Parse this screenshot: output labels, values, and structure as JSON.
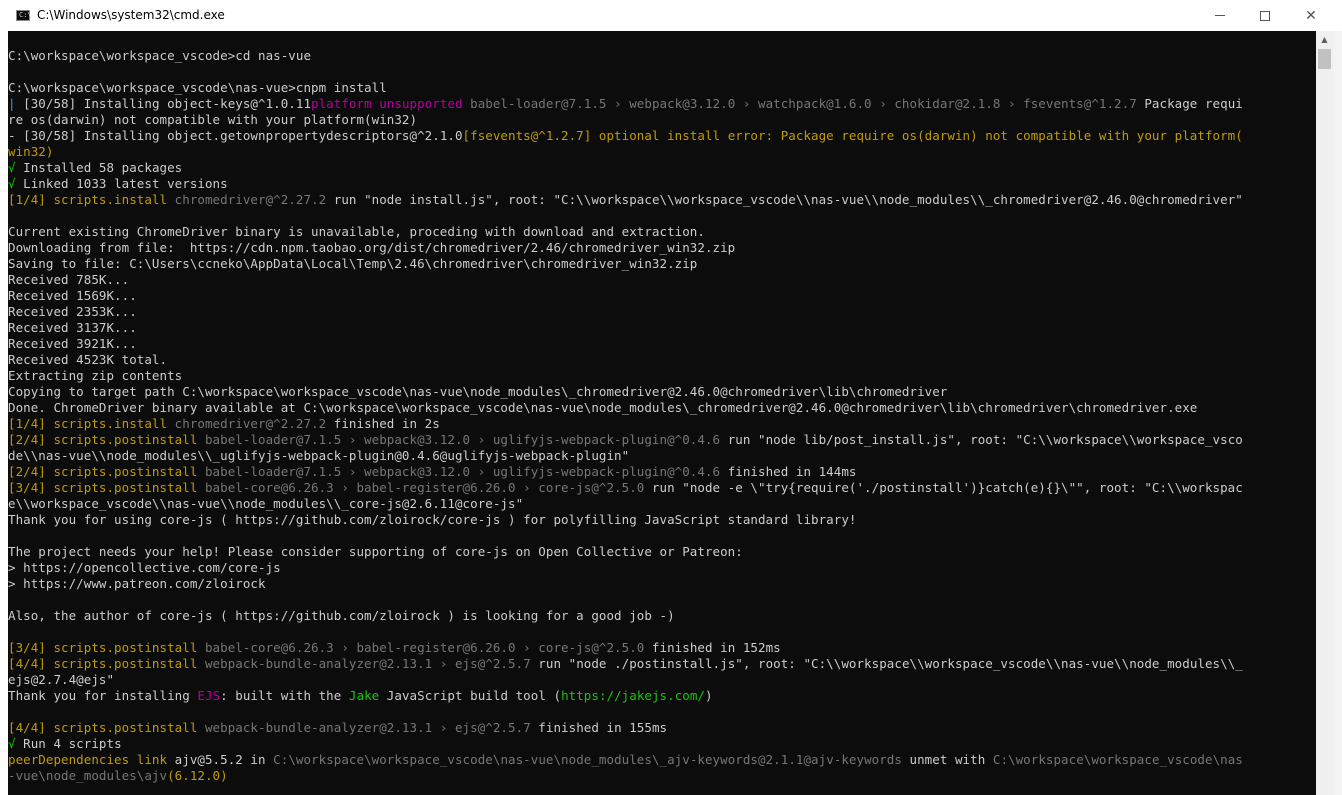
{
  "window": {
    "title": "C:\\Windows\\system32\\cmd.exe",
    "icon": "cmd-icon",
    "icon_text": "C:\\",
    "minimize_icon": "minimize-icon",
    "maximize_icon": "maximize-icon",
    "close_icon": "close-icon"
  },
  "colors": {
    "console_bg": "#0c0c0c",
    "default_text": "#cccccc",
    "blue": "#3a96dd",
    "green": "#16c60c",
    "yellow": "#c19c00",
    "gray": "#767676",
    "magenta": "#b4009e"
  },
  "console": {
    "lines": [
      [
        {
          "t": "C:\\workspace\\workspace_vscode>cd nas-vue",
          "c": "white"
        }
      ],
      [
        {
          "t": "",
          "c": "white"
        }
      ],
      [
        {
          "t": "C:\\workspace\\workspace_vscode\\nas-vue>cnpm install",
          "c": "white"
        }
      ],
      [
        {
          "t": "| ",
          "c": "blue"
        },
        {
          "t": "[30/58] Installing object-keys@^1.0.11",
          "c": "white"
        },
        {
          "t": "platform unsupported ",
          "c": "magenta"
        },
        {
          "t": "babel-loader@7.1.5 › webpack@3.12.0 › watchpack@1.6.0 › chokidar@2.1.8 › fsevents@^1.2.7",
          "c": "gray"
        },
        {
          "t": " Package requi",
          "c": "white"
        }
      ],
      [
        {
          "t": "re os(darwin) not compatible with your platform(win32)",
          "c": "white"
        }
      ],
      [
        {
          "t": "- ",
          "c": "white"
        },
        {
          "t": "[30/58] Installing object.getownpropertydescriptors@^2.1.0",
          "c": "white"
        },
        {
          "t": "[fsevents@^1.2.7] optional install error: Package require os(darwin) not compatible with your platform(",
          "c": "yellow"
        }
      ],
      [
        {
          "t": "win32)",
          "c": "yellow"
        }
      ],
      [
        {
          "t": "√ ",
          "c": "green"
        },
        {
          "t": "Installed 58 packages",
          "c": "white"
        }
      ],
      [
        {
          "t": "√ ",
          "c": "green"
        },
        {
          "t": "Linked 1033 latest versions",
          "c": "white"
        }
      ],
      [
        {
          "t": "[1/4] scripts.install ",
          "c": "yellow"
        },
        {
          "t": "chromedriver@^2.27.2",
          "c": "gray"
        },
        {
          "t": " run \"node install.js\", root: \"C:\\\\workspace\\\\workspace_vscode\\\\nas-vue\\\\node_modules\\\\_chromedriver@2.46.0@chromedriver\"",
          "c": "white"
        }
      ],
      [
        {
          "t": "",
          "c": "white"
        }
      ],
      [
        {
          "t": "Current existing ChromeDriver binary is unavailable, proceding with download and extraction.",
          "c": "white"
        }
      ],
      [
        {
          "t": "Downloading from file:  https://cdn.npm.taobao.org/dist/chromedriver/2.46/chromedriver_win32.zip",
          "c": "white"
        }
      ],
      [
        {
          "t": "Saving to file: C:\\Users\\ccneko\\AppData\\Local\\Temp\\2.46\\chromedriver\\chromedriver_win32.zip",
          "c": "white"
        }
      ],
      [
        {
          "t": "Received 785K...",
          "c": "white"
        }
      ],
      [
        {
          "t": "Received 1569K...",
          "c": "white"
        }
      ],
      [
        {
          "t": "Received 2353K...",
          "c": "white"
        }
      ],
      [
        {
          "t": "Received 3137K...",
          "c": "white"
        }
      ],
      [
        {
          "t": "Received 3921K...",
          "c": "white"
        }
      ],
      [
        {
          "t": "Received 4523K total.",
          "c": "white"
        }
      ],
      [
        {
          "t": "Extracting zip contents",
          "c": "white"
        }
      ],
      [
        {
          "t": "Copying to target path C:\\workspace\\workspace_vscode\\nas-vue\\node_modules\\_chromedriver@2.46.0@chromedriver\\lib\\chromedriver",
          "c": "white"
        }
      ],
      [
        {
          "t": "Done. ChromeDriver binary available at C:\\workspace\\workspace_vscode\\nas-vue\\node_modules\\_chromedriver@2.46.0@chromedriver\\lib\\chromedriver\\chromedriver.exe",
          "c": "white"
        }
      ],
      [
        {
          "t": "[1/4] scripts.install ",
          "c": "yellow"
        },
        {
          "t": "chromedriver@^2.27.2",
          "c": "gray"
        },
        {
          "t": " finished in 2s",
          "c": "white"
        }
      ],
      [
        {
          "t": "[2/4] scripts.postinstall ",
          "c": "yellow"
        },
        {
          "t": "babel-loader@7.1.5 › webpack@3.12.0 › uglifyjs-webpack-plugin@^0.4.6",
          "c": "gray"
        },
        {
          "t": " run \"node lib/post_install.js\", root: \"C:\\\\workspace\\\\workspace_vsco",
          "c": "white"
        }
      ],
      [
        {
          "t": "de\\\\nas-vue\\\\node_modules\\\\_uglifyjs-webpack-plugin@0.4.6@uglifyjs-webpack-plugin\"",
          "c": "white"
        }
      ],
      [
        {
          "t": "[2/4] scripts.postinstall ",
          "c": "yellow"
        },
        {
          "t": "babel-loader@7.1.5 › webpack@3.12.0 › uglifyjs-webpack-plugin@^0.4.6",
          "c": "gray"
        },
        {
          "t": " finished in 144ms",
          "c": "white"
        }
      ],
      [
        {
          "t": "[3/4] scripts.postinstall ",
          "c": "yellow"
        },
        {
          "t": "babel-core@6.26.3 › babel-register@6.26.0 › core-js@^2.5.0",
          "c": "gray"
        },
        {
          "t": " run \"node -e \\\"try{require('./postinstall')}catch(e){}\\\"\", root: \"C:\\\\workspac",
          "c": "white"
        }
      ],
      [
        {
          "t": "e\\\\workspace_vscode\\\\nas-vue\\\\node_modules\\\\_core-js@2.6.11@core-js\"",
          "c": "white"
        }
      ],
      [
        {
          "t": "Thank you for using core-js ( https://github.com/zloirock/core-js ) for polyfilling JavaScript standard library!",
          "c": "white"
        }
      ],
      [
        {
          "t": "",
          "c": "white"
        }
      ],
      [
        {
          "t": "The project needs your help! Please consider supporting of core-js on Open Collective or Patreon:",
          "c": "white"
        }
      ],
      [
        {
          "t": "> https://opencollective.com/core-js",
          "c": "white"
        }
      ],
      [
        {
          "t": "> https://www.patreon.com/zloirock",
          "c": "white"
        }
      ],
      [
        {
          "t": "",
          "c": "white"
        }
      ],
      [
        {
          "t": "Also, the author of core-js ( https://github.com/zloirock ) is looking for a good job -)",
          "c": "white"
        }
      ],
      [
        {
          "t": "",
          "c": "white"
        }
      ],
      [
        {
          "t": "[3/4] scripts.postinstall ",
          "c": "yellow"
        },
        {
          "t": "babel-core@6.26.3 › babel-register@6.26.0 › core-js@^2.5.0",
          "c": "gray"
        },
        {
          "t": " finished in 152ms",
          "c": "white"
        }
      ],
      [
        {
          "t": "[4/4] scripts.postinstall ",
          "c": "yellow"
        },
        {
          "t": "webpack-bundle-analyzer@2.13.1 › ejs@^2.5.7",
          "c": "gray"
        },
        {
          "t": " run \"node ./postinstall.js\", root: \"C:\\\\workspace\\\\workspace_vscode\\\\nas-vue\\\\node_modules\\\\_",
          "c": "white"
        }
      ],
      [
        {
          "t": "ejs@2.7.4@ejs\"",
          "c": "white"
        }
      ],
      [
        {
          "t": "Thank you for installing ",
          "c": "white"
        },
        {
          "t": "EJS",
          "c": "magenta"
        },
        {
          "t": ": built with the ",
          "c": "white"
        },
        {
          "t": "Jake",
          "c": "green"
        },
        {
          "t": " JavaScript build tool (",
          "c": "white"
        },
        {
          "t": "https://jakejs.com/",
          "c": "green"
        },
        {
          "t": ")",
          "c": "white"
        }
      ],
      [
        {
          "t": "",
          "c": "white"
        }
      ],
      [
        {
          "t": "[4/4] scripts.postinstall ",
          "c": "yellow"
        },
        {
          "t": "webpack-bundle-analyzer@2.13.1 › ejs@^2.5.7",
          "c": "gray"
        },
        {
          "t": " finished in 155ms",
          "c": "white"
        }
      ],
      [
        {
          "t": "√ ",
          "c": "green"
        },
        {
          "t": "Run 4 scripts",
          "c": "white"
        }
      ],
      [
        {
          "t": "peerDependencies link ",
          "c": "yellow"
        },
        {
          "t": "ajv@5.5.2",
          "c": "white"
        },
        {
          "t": " in ",
          "c": "white"
        },
        {
          "t": "C:\\workspace\\workspace_vscode\\nas-vue\\node_modules\\_ajv-keywords@2.1.1@ajv-keywords",
          "c": "gray"
        },
        {
          "t": " unmet with ",
          "c": "white"
        },
        {
          "t": "C:\\workspace\\workspace_vscode\\nas",
          "c": "gray"
        }
      ],
      [
        {
          "t": "-vue\\node_modules\\ajv",
          "c": "gray"
        },
        {
          "t": "(6.12.0)",
          "c": "yellow"
        }
      ]
    ]
  },
  "scrollbar": {
    "up_icon": "scroll-up-arrow-icon",
    "up_glyph": "▲"
  }
}
